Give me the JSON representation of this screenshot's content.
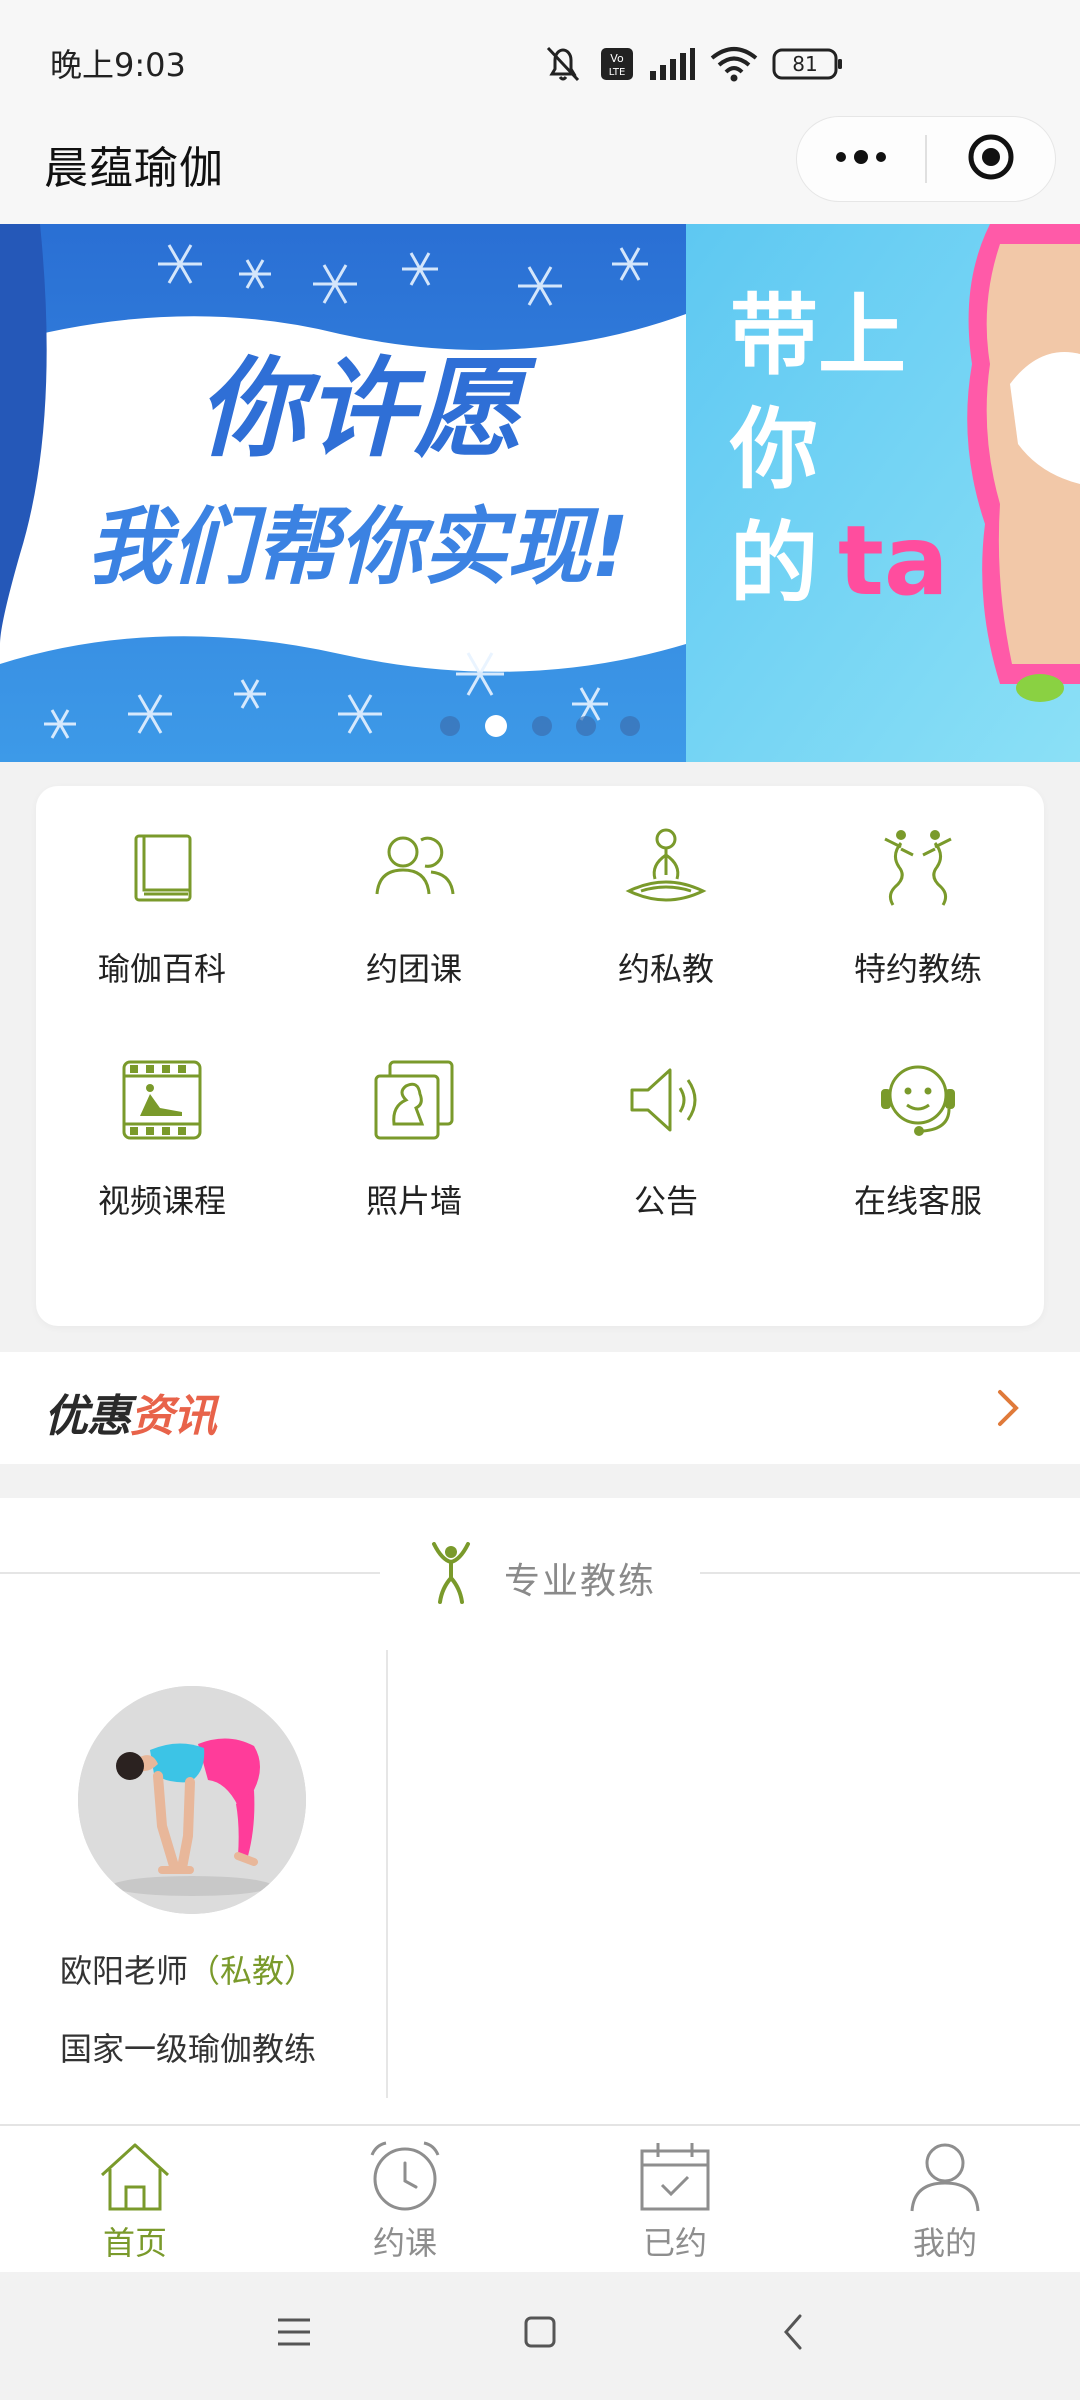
{
  "status_bar": {
    "time": "晚上9:03",
    "battery": "81",
    "icons": [
      "mute-icon",
      "volte-icon",
      "signal-icon",
      "wifi-icon",
      "battery-icon"
    ]
  },
  "nav": {
    "title": "晨蕴瑜伽",
    "more_icon": "more-dots-icon",
    "close_icon": "target-close-icon"
  },
  "banner": {
    "slide1_line1": "你许愿",
    "slide1_line2": "我们帮你实现!",
    "slide2_line1": "带上",
    "slide2_line2": "你",
    "slide2_line3a": "的",
    "slide2_line3b": "ta",
    "dots_count": 5,
    "active_dot": 1
  },
  "grid": [
    {
      "label": "瑜伽百科",
      "icon": "book-icon"
    },
    {
      "label": "约团课",
      "icon": "group-icon"
    },
    {
      "label": "约私教",
      "icon": "meditation-icon"
    },
    {
      "label": "特约教练",
      "icon": "dancers-icon"
    },
    {
      "label": "视频课程",
      "icon": "video-film-icon"
    },
    {
      "label": "照片墙",
      "icon": "photo-wall-icon"
    },
    {
      "label": "公告",
      "icon": "speaker-icon"
    },
    {
      "label": "在线客服",
      "icon": "headset-icon"
    }
  ],
  "promo": {
    "title_part1": "优惠",
    "title_part2": "资讯"
  },
  "coaches_section": {
    "title": "专业教练",
    "coach": {
      "name": "欧阳老师",
      "type": "（私教）",
      "title": "国家一级瑜伽教练"
    }
  },
  "tabbar": [
    {
      "label": "首页",
      "icon": "home-icon",
      "active": true
    },
    {
      "label": "约课",
      "icon": "alarm-clock-icon",
      "active": false
    },
    {
      "label": "已约",
      "icon": "calendar-check-icon",
      "active": false
    },
    {
      "label": "我的",
      "icon": "user-icon",
      "active": false
    }
  ],
  "colors": {
    "accent_green": "#7a9a2b",
    "promo_orange": "#e8634a",
    "banner_blue": "#2f7fd8"
  }
}
